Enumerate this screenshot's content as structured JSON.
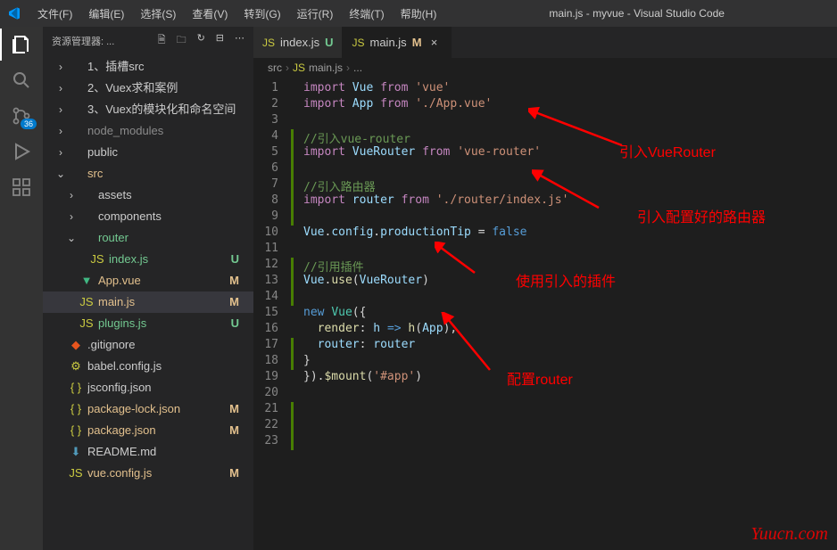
{
  "window_title": "main.js - myvue - Visual Studio Code",
  "menu": [
    "文件(F)",
    "编辑(E)",
    "选择(S)",
    "查看(V)",
    "转到(G)",
    "运行(R)",
    "终端(T)",
    "帮助(H)"
  ],
  "scm_badge": "36",
  "sidebar": {
    "title": "资源管理器: ...",
    "items": [
      {
        "indent": 1,
        "chev": "›",
        "icon": "folder",
        "label": "1、插槽src",
        "status": "",
        "cls": ""
      },
      {
        "indent": 1,
        "chev": "›",
        "icon": "folder",
        "label": "2、Vuex求和案例",
        "status": "",
        "cls": ""
      },
      {
        "indent": 1,
        "chev": "›",
        "icon": "folder",
        "label": "3、Vuex的模块化和命名空间",
        "status": "",
        "cls": ""
      },
      {
        "indent": 1,
        "chev": "›",
        "icon": "folder",
        "label": "node_modules",
        "status": "",
        "cls": "",
        "dim": true
      },
      {
        "indent": 1,
        "chev": "›",
        "icon": "folder",
        "label": "public",
        "status": "",
        "cls": ""
      },
      {
        "indent": 1,
        "chev": "⌄",
        "icon": "folder",
        "label": "src",
        "status": "",
        "cls": "col-orange"
      },
      {
        "indent": 2,
        "chev": "›",
        "icon": "folder",
        "label": "assets",
        "status": "",
        "cls": ""
      },
      {
        "indent": 2,
        "chev": "›",
        "icon": "folder",
        "label": "components",
        "status": "",
        "cls": ""
      },
      {
        "indent": 2,
        "chev": "⌄",
        "icon": "folder",
        "label": "router",
        "status": "",
        "cls": "col-green"
      },
      {
        "indent": 3,
        "chev": "",
        "icon": "js",
        "label": "index.js",
        "status": "U",
        "cls": "col-green"
      },
      {
        "indent": 2,
        "chev": "",
        "icon": "vue",
        "label": "App.vue",
        "status": "M",
        "cls": "col-orange"
      },
      {
        "indent": 2,
        "chev": "",
        "icon": "js",
        "label": "main.js",
        "status": "M",
        "cls": "col-orange",
        "selected": true
      },
      {
        "indent": 2,
        "chev": "",
        "icon": "js",
        "label": "plugins.js",
        "status": "U",
        "cls": "col-green"
      },
      {
        "indent": 1,
        "chev": "",
        "icon": "git",
        "label": ".gitignore",
        "status": "",
        "cls": ""
      },
      {
        "indent": 1,
        "chev": "",
        "icon": "babel",
        "label": "babel.config.js",
        "status": "",
        "cls": ""
      },
      {
        "indent": 1,
        "chev": "",
        "icon": "json",
        "label": "jsconfig.json",
        "status": "",
        "cls": ""
      },
      {
        "indent": 1,
        "chev": "",
        "icon": "json",
        "label": "package-lock.json",
        "status": "M",
        "cls": "col-orange"
      },
      {
        "indent": 1,
        "chev": "",
        "icon": "json",
        "label": "package.json",
        "status": "M",
        "cls": "col-orange"
      },
      {
        "indent": 1,
        "chev": "",
        "icon": "md",
        "label": "README.md",
        "status": "",
        "cls": ""
      },
      {
        "indent": 1,
        "chev": "",
        "icon": "js",
        "label": "vue.config.js",
        "status": "M",
        "cls": "col-orange"
      }
    ]
  },
  "tabs": [
    {
      "icon": "JS",
      "label": "index.js",
      "status": "U",
      "statusCls": "col-green",
      "active": false
    },
    {
      "icon": "JS",
      "label": "main.js",
      "status": "M",
      "statusCls": "col-orange",
      "active": true
    }
  ],
  "breadcrumb": [
    "src",
    "main.js",
    "..."
  ],
  "code": [
    {
      "n": 1,
      "h": "<span class='tok-key'>import</span> <span class='tok-var'>Vue</span> <span class='tok-key'>from</span> <span class='tok-str'>'vue'</span>"
    },
    {
      "n": 2,
      "h": "<span class='tok-key'>import</span> <span class='tok-var'>App</span> <span class='tok-key'>from</span> <span class='tok-str'>'./App.vue'</span>"
    },
    {
      "n": 3,
      "h": ""
    },
    {
      "n": 4,
      "h": "<span class='tok-com'>//引入vue-router</span>",
      "mod": true
    },
    {
      "n": 5,
      "h": "<span class='tok-key'>import</span> <span class='tok-var'>VueRouter</span> <span class='tok-key'>from</span> <span class='tok-str'>'vue-router'</span>",
      "mod": true
    },
    {
      "n": 6,
      "h": "",
      "mod": true
    },
    {
      "n": 7,
      "h": "<span class='tok-com'>//引入路由器</span>",
      "mod": true
    },
    {
      "n": 8,
      "h": "<span class='tok-key'>import</span> <span class='tok-var'>router</span> <span class='tok-key'>from</span> <span class='tok-str'>'./router/index.js'</span>",
      "mod": true
    },
    {
      "n": 9,
      "h": "",
      "mod": true
    },
    {
      "n": 10,
      "h": "<span class='tok-var'>Vue</span><span class='tok-plain'>.</span><span class='tok-var'>config</span><span class='tok-plain'>.</span><span class='tok-var'>productionTip</span> <span class='tok-plain'>=</span> <span class='tok-const'>false</span>"
    },
    {
      "n": 11,
      "h": ""
    },
    {
      "n": 12,
      "h": "<span class='tok-com'>//引用插件</span>",
      "mod": true
    },
    {
      "n": 13,
      "h": "<span class='tok-var'>Vue</span><span class='tok-plain'>.</span><span class='tok-func'>use</span><span class='tok-plain'>(</span><span class='tok-var'>VueRouter</span><span class='tok-plain'>)</span>",
      "mod": true
    },
    {
      "n": 14,
      "h": "",
      "mod": true
    },
    {
      "n": 15,
      "h": "<span class='tok-const'>new</span> <span class='tok-type'>Vue</span><span class='tok-plain'>({</span>"
    },
    {
      "n": 16,
      "h": "  <span class='tok-func'>render</span><span class='tok-plain'>:</span> <span class='tok-var'>h</span> <span class='tok-const'>=></span> <span class='tok-func'>h</span><span class='tok-plain'>(</span><span class='tok-var'>App</span><span class='tok-plain'>),</span>"
    },
    {
      "n": 17,
      "h": "  <span class='tok-var'>router</span><span class='tok-plain'>:</span> <span class='tok-var'>router</span>",
      "mod": true
    },
    {
      "n": 18,
      "h": "<span class='tok-plain'>}</span>",
      "mod": true
    },
    {
      "n": 19,
      "h": "<span class='tok-plain'>}).</span><span class='tok-func'>$mount</span><span class='tok-plain'>(</span><span class='tok-str'>'#app'</span><span class='tok-plain'>)</span>"
    },
    {
      "n": 20,
      "h": ""
    },
    {
      "n": 21,
      "h": "",
      "mod": true
    },
    {
      "n": 22,
      "h": "",
      "mod": true
    },
    {
      "n": 23,
      "h": "",
      "mod": true
    }
  ],
  "annotations": {
    "a1": "引入VueRouter",
    "a2": "引入配置好的路由器",
    "a3": "使用引入的插件",
    "a4": "配置router"
  },
  "watermark": "Yuucn.com"
}
